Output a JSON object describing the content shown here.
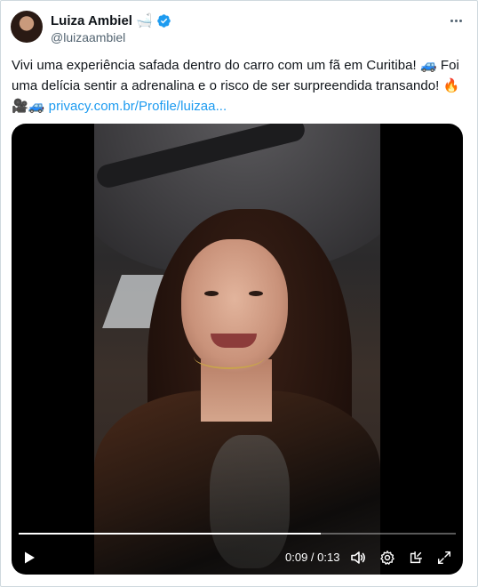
{
  "author": {
    "display_name": "Luiza Ambiel",
    "name_emoji": "🛁",
    "handle": "@luizaambiel",
    "verified": true
  },
  "tweet": {
    "text_line1": "Vivi uma experiência safada dentro do carro com um fã em Curitiba! 🚙 Foi",
    "text_line2": "uma delícia sentir a adrenalina e o risco de ser surpreendida transando! 🔥",
    "text_line3_emojis": "🎥🚙 ",
    "link_text": "privacy.com.br/Profile/luizaa..."
  },
  "video": {
    "current_time": "0:09",
    "separator": " / ",
    "duration": "0:13",
    "progress_fraction": 0.692
  },
  "icons": {
    "more": "more-horizontal-icon",
    "verified": "verified-badge-icon",
    "play": "play-icon",
    "volume": "volume-icon",
    "settings": "settings-gear-icon",
    "popout": "popout-icon",
    "fullscreen": "fullscreen-icon"
  },
  "colors": {
    "verified_blue": "#1d9bf0",
    "link": "#1d9bf0",
    "secondary_text": "#536471"
  }
}
